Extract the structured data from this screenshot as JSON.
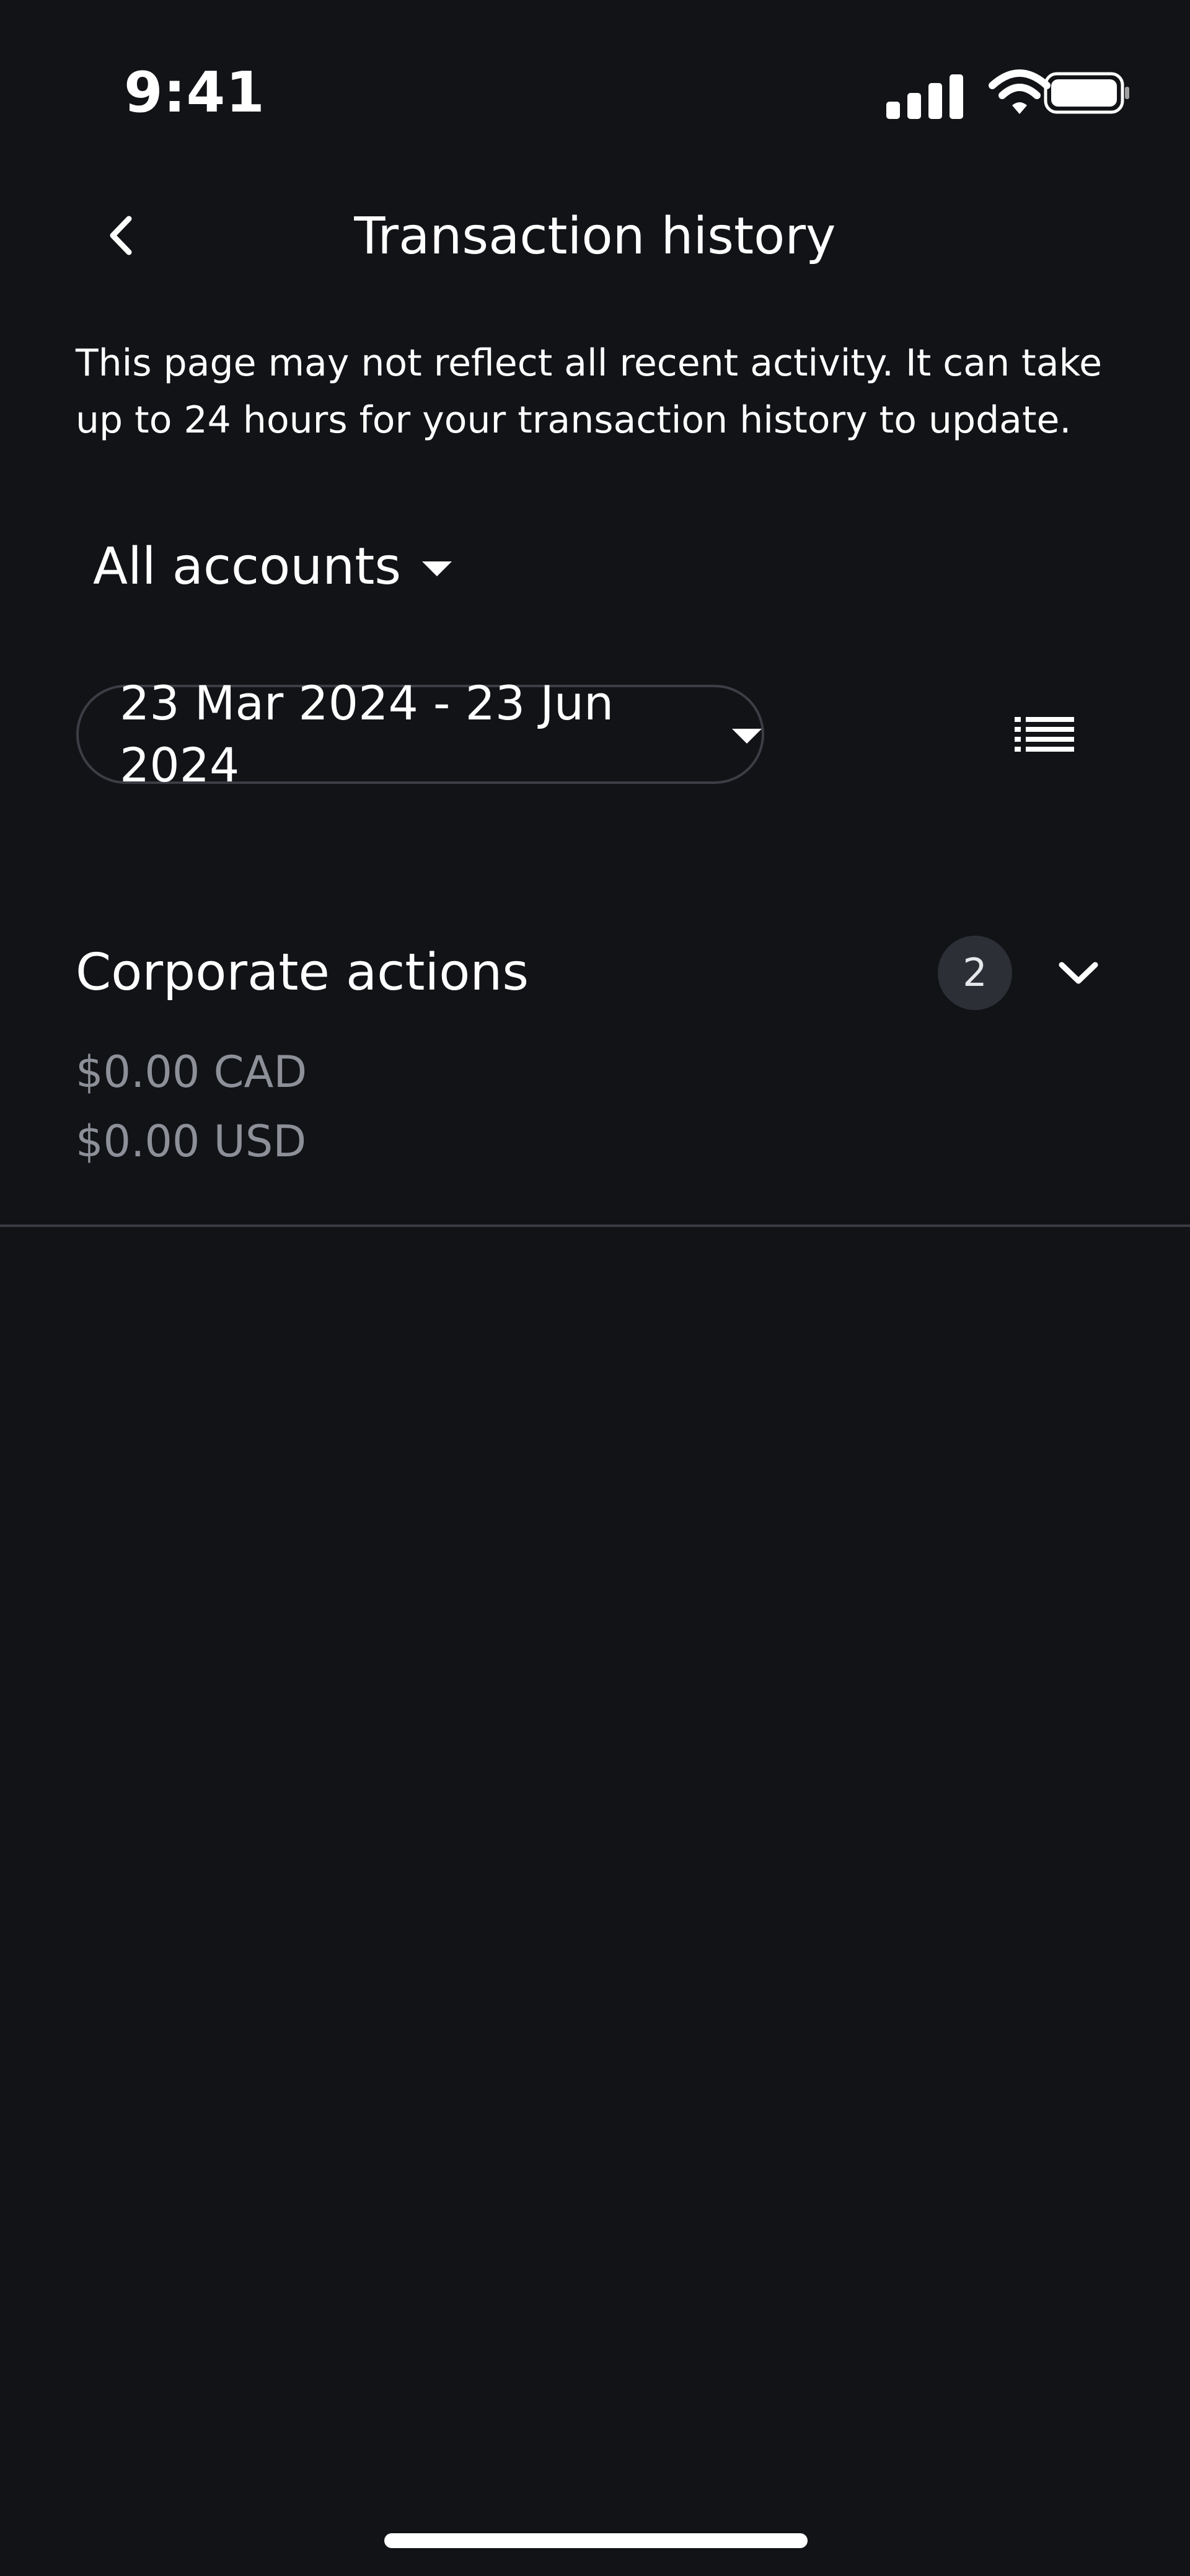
{
  "status_bar": {
    "time": "9:41",
    "icons": [
      "cellular-signal-icon",
      "wifi-icon",
      "battery-icon"
    ]
  },
  "header": {
    "title": "Transaction history",
    "back_icon": "chevron-left-icon"
  },
  "notice": {
    "text": "This page may not reflect all recent activity. It can take up to 24 hours for your transaction history to update."
  },
  "filters": {
    "account_selector": "All accounts",
    "date_range": "23 Mar 2024 - 23 Jun 2024",
    "view_toggle_icon": "list-icon"
  },
  "sections": [
    {
      "title": "Corporate actions",
      "count": "2",
      "amounts": [
        "$0.00 CAD",
        "$0.00 USD"
      ],
      "expand_icon": "chevron-down-icon"
    }
  ],
  "colors": {
    "background": "#121317",
    "text_primary": "#ffffff",
    "text_secondary": "#8d9098",
    "pill_border": "#3c3e45",
    "badge_bg": "#2c2f35",
    "divider": "#3a3c42"
  }
}
